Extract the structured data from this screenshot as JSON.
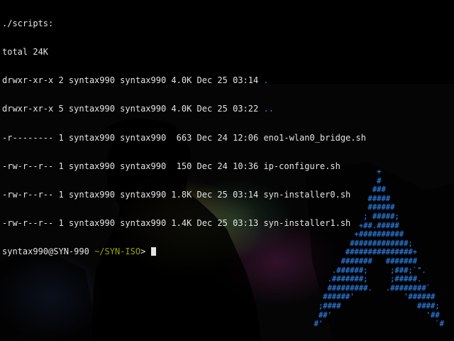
{
  "terminal": {
    "lines": [
      "./scripts:",
      "total 24K",
      "drwxr-xr-x 2 syntax990 syntax990 4.0K Dec 25 03:14 ",
      "drwxr-xr-x 5 syntax990 syntax990 4.0K Dec 25 03:22 ",
      "-r-------- 1 syntax990 syntax990  663 Dec 24 12:06 eno1-wlan0_bridge.sh",
      "-rw-r--r-- 1 syntax990 syntax990  150 Dec 24 10:36 ip-configure.sh",
      "-rw-r--r-- 1 syntax990 syntax990 1.8K Dec 25 03:14 syn-installer0.sh",
      "-rw-r--r-- 1 syntax990 syntax990 1.4K Dec 25 03:13 syn-installer1.sh"
    ],
    "dir_entries": [
      ".",
      ".."
    ],
    "prompt": {
      "user_host": "syntax990@SYN-990",
      "path": "~/SYN-ISO",
      "symbol": ">"
    }
  },
  "arch_logo": {
    "ascii": "                +\n                #\n               ###\n              #####\n              ######\n             ; #####;\n            +##.#####\n           +##########\n          #############;\n         ###############+\n        #######   #######\n      .######;     ;###;`\".\n     .#######;     ;#####.\n     #########.   .########`\n    ######'           '######\n   ;####                 ####;\n   ##'                     '##\n  #'                         `#"
  },
  "colors": {
    "text": "#e4e4e4",
    "directory": "#3a7ad6",
    "path": "#9aa300",
    "logo": "#2f7fd8",
    "background": "#000000"
  }
}
